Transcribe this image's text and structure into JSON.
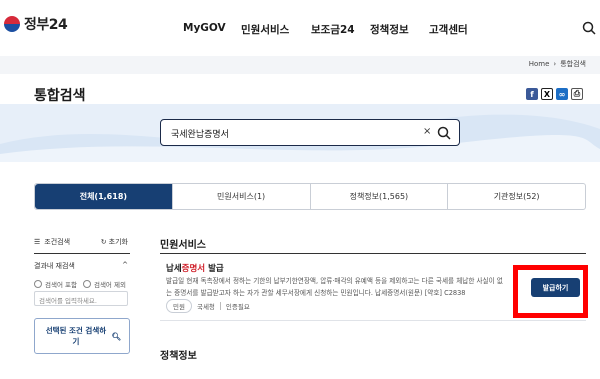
{
  "header": {
    "logo_text": "정부24",
    "nav": [
      "MyGOV",
      "민원서비스",
      "보조금24",
      "정책정보",
      "고객센터"
    ]
  },
  "breadcrumb": {
    "home": "Home",
    "current": "통합검색"
  },
  "page": {
    "title": "통합검색"
  },
  "share_icons": [
    "facebook-icon",
    "x-icon",
    "link-icon",
    "print-icon"
  ],
  "search": {
    "query": "국세완납증명서"
  },
  "tabs": [
    {
      "label": "전체(1,618)",
      "active": true
    },
    {
      "label": "민원서비스(1)",
      "active": false
    },
    {
      "label": "정책정보(1,565)",
      "active": false
    },
    {
      "label": "기관정보(52)",
      "active": false
    }
  ],
  "filters": {
    "conditions_label": "조건검색",
    "reset_label": "초기화",
    "refine_label": "결과내 재검색",
    "radio_include": "검색어 포함",
    "radio_exclude": "검색어 제외",
    "input_placeholder": "검색어를 입력하세요.",
    "apply_label": "선택된 조건 검색하기"
  },
  "results": {
    "section_1": "민원서비스",
    "item": {
      "title_prefix": "납세",
      "title_highlight": "증명서",
      "title_suffix": " 발급",
      "desc_line1": "발급일 현재 독촉장에서 정하는 기한의 납부기한연장액, 압류·매각의 유예액 등을 제외하고는 다른 국세를 체납한 사실이 없",
      "desc_line2": "는 증명서를 발급받고자 하는 자가 관할 세무서장에게 신청하는 민원입니다. 납세증명서(원문) [약호] C2838",
      "chip": "민원",
      "agency": "국세청",
      "auth": "인증필요",
      "issue_label": "발급하기"
    },
    "section_2": "정책정보"
  }
}
